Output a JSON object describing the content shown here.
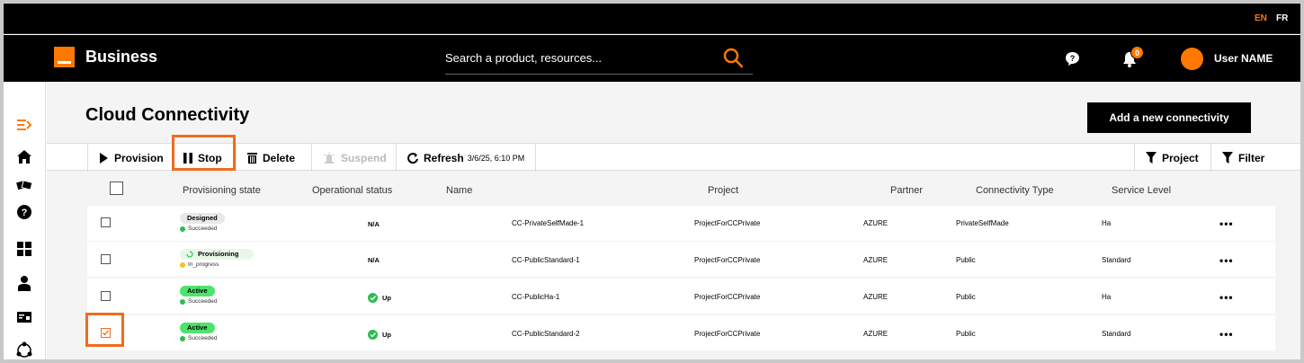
{
  "topbar": {
    "lang_en": "EN",
    "lang_fr": "FR"
  },
  "header": {
    "brand": "Business",
    "search_placeholder": "Search a product, resources...",
    "notification_count": "0",
    "user_name": "User NAME"
  },
  "page": {
    "title": "Cloud Connectivity",
    "add_button": "Add a new connectivity"
  },
  "toolbar": {
    "provision": "Provision",
    "stop": "Stop",
    "delete": "Delete",
    "suspend": "Suspend",
    "refresh": "Refresh",
    "refresh_time": "3/6/25, 6:10 PM",
    "project": "Project",
    "filter": "Filter"
  },
  "table": {
    "headers": {
      "provisioning_state": "Provisioning state",
      "operational_status": "Operational status",
      "name": "Name",
      "project": "Project",
      "partner": "Partner",
      "connectivity_type": "Connectivity Type",
      "service_level": "Service Level"
    },
    "rows": [
      {
        "state": "Designed",
        "substate": "Succeeded",
        "op": "N/A",
        "name": "CC-PrivateSelfMade-1",
        "project": "ProjectForCCPrivate",
        "partner": "AZURE",
        "type": "PrivateSelfMade",
        "level": "Ha",
        "checked": false
      },
      {
        "state": "Provisioning",
        "substate": "In_progress",
        "op": "N/A",
        "name": "CC-PublicStandard-1",
        "project": "ProjectForCCPrivate",
        "partner": "AZURE",
        "type": "Public",
        "level": "Standard",
        "checked": false
      },
      {
        "state": "Active",
        "substate": "Succeeded",
        "op": "Up",
        "name": "CC-PublicHa-1",
        "project": "ProjectForCCPrivate",
        "partner": "AZURE",
        "type": "Public",
        "level": "Ha",
        "checked": false
      },
      {
        "state": "Active",
        "substate": "Succeeded",
        "op": "Up",
        "name": "CC-PublicStandard-2",
        "project": "ProjectForCCPrivate",
        "partner": "AZURE",
        "type": "Public",
        "level": "Standard",
        "checked": true
      }
    ]
  },
  "colors": {
    "accent": "#ff7900",
    "highlight": "#f26b1d",
    "active": "#4de36c",
    "ok": "#2bbd4f"
  }
}
